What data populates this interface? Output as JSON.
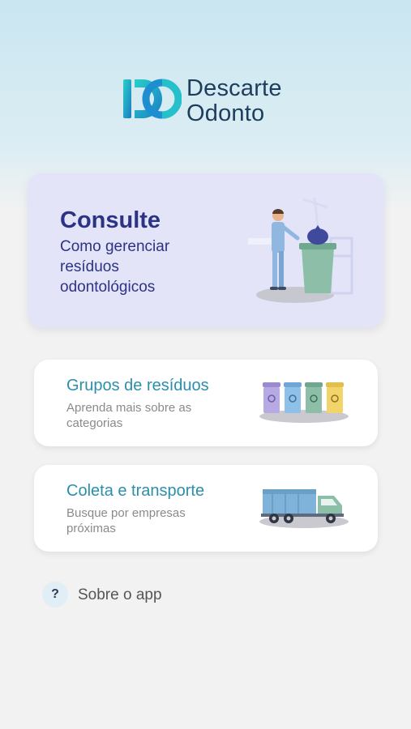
{
  "app": {
    "logo_line1": "Descarte",
    "logo_line2": "Odonto"
  },
  "hero": {
    "title": "Consulte",
    "subtitle": "Como gerenciar resíduos odontológicos"
  },
  "cards": [
    {
      "title": "Grupos de resíduos",
      "description": "Aprenda mais sobre as categorias",
      "icon": "waste-bins-icon"
    },
    {
      "title": "Coleta e transporte",
      "description": "Busque por empresas próximas",
      "icon": "garbage-truck-icon"
    }
  ],
  "about": {
    "icon_glyph": "?",
    "label": "Sobre o app"
  },
  "colors": {
    "primary_dark": "#2c3384",
    "teal": "#2c8fa9",
    "hero_bg": "#e4e4f9"
  }
}
